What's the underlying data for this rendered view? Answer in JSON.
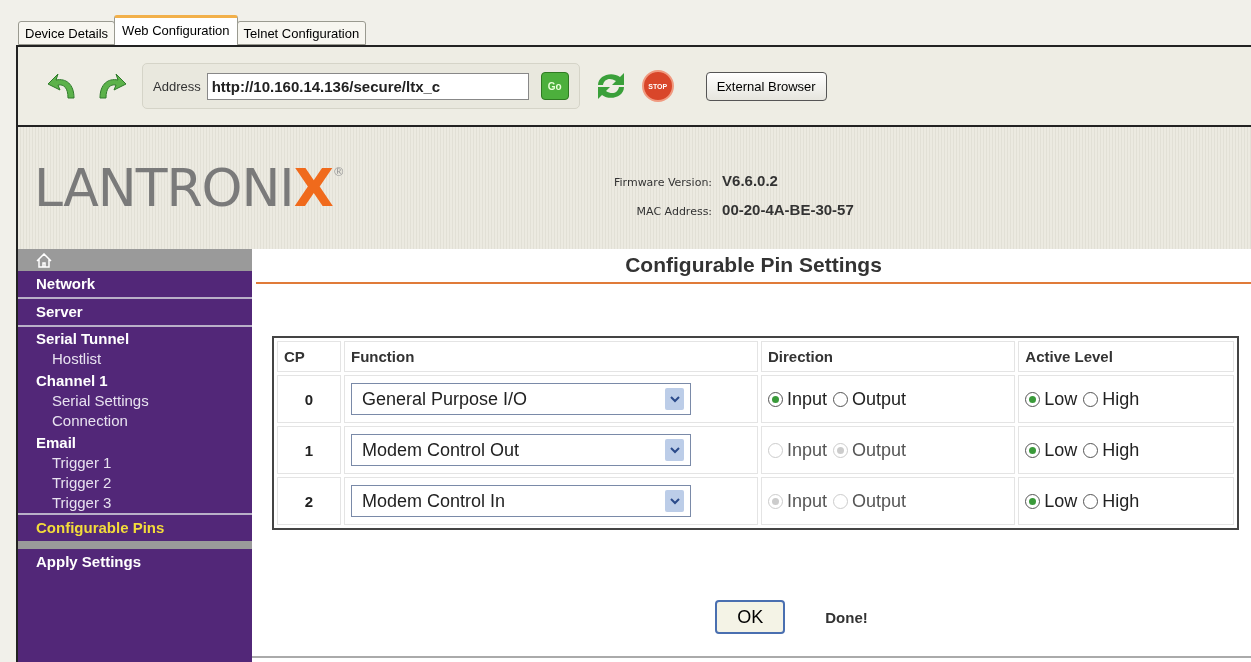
{
  "tabs": [
    {
      "label": "Device Details",
      "selected": false
    },
    {
      "label": "Web Configuration",
      "selected": true
    },
    {
      "label": "Telnet Configuration",
      "selected": false
    }
  ],
  "toolbar": {
    "address_label": "Address",
    "address": "http://10.160.14.136/secure/ltx_c",
    "go": "Go",
    "stop": "STOP",
    "external": "External Browser"
  },
  "header": {
    "logo": {
      "text": "LANTRONI",
      "accent": "X",
      "mark": "®"
    },
    "info": [
      {
        "label": "Firmware Version:",
        "value": "V6.6.0.2"
      },
      {
        "label": "MAC Address:",
        "value": "00-20-4A-BE-30-57"
      }
    ]
  },
  "sidebar": {
    "items": [
      {
        "label": "Network",
        "kind": "section",
        "selected": false
      },
      {
        "label": "Server",
        "kind": "section",
        "selected": false
      },
      {
        "label": "Serial Tunnel",
        "kind": "group",
        "selected": false,
        "children": [
          {
            "label": "Hostlist",
            "selected": false
          }
        ]
      },
      {
        "label": "Channel 1",
        "kind": "group",
        "selected": false,
        "children": [
          {
            "label": "Serial Settings",
            "selected": false
          },
          {
            "label": "Connection",
            "selected": false
          }
        ]
      },
      {
        "label": "Email",
        "kind": "group",
        "selected": false,
        "children": [
          {
            "label": "Trigger 1",
            "selected": false
          },
          {
            "label": "Trigger 2",
            "selected": false
          },
          {
            "label": "Trigger 3",
            "selected": false
          }
        ]
      },
      {
        "label": "Configurable Pins",
        "kind": "section",
        "selected": true
      },
      {
        "label": "Apply Settings",
        "kind": "section",
        "selected": false
      }
    ]
  },
  "page_title": "Configurable Pin Settings",
  "table": {
    "columns": [
      "CP",
      "Function",
      "Direction",
      "Active Level"
    ],
    "rows": [
      {
        "cp": "0",
        "function": "General Purpose I/O",
        "direction": [
          {
            "label": "Input",
            "selected": true,
            "disabled": false
          },
          {
            "label": "Output",
            "selected": false,
            "disabled": false
          }
        ],
        "level": [
          {
            "label": "Low",
            "selected": true,
            "disabled": false
          },
          {
            "label": "High",
            "selected": false,
            "disabled": false
          }
        ]
      },
      {
        "cp": "1",
        "function": "Modem Control Out",
        "direction": [
          {
            "label": "Input",
            "selected": false,
            "disabled": true
          },
          {
            "label": "Output",
            "selected": true,
            "disabled": true
          }
        ],
        "level": [
          {
            "label": "Low",
            "selected": true,
            "disabled": false
          },
          {
            "label": "High",
            "selected": false,
            "disabled": false
          }
        ]
      },
      {
        "cp": "2",
        "function": "Modem Control In",
        "direction": [
          {
            "label": "Input",
            "selected": true,
            "disabled": true
          },
          {
            "label": "Output",
            "selected": false,
            "disabled": true
          }
        ],
        "level": [
          {
            "label": "Low",
            "selected": true,
            "disabled": false
          },
          {
            "label": "High",
            "selected": false,
            "disabled": false
          }
        ]
      }
    ]
  },
  "ok_button": "OK",
  "status": "Done!"
}
